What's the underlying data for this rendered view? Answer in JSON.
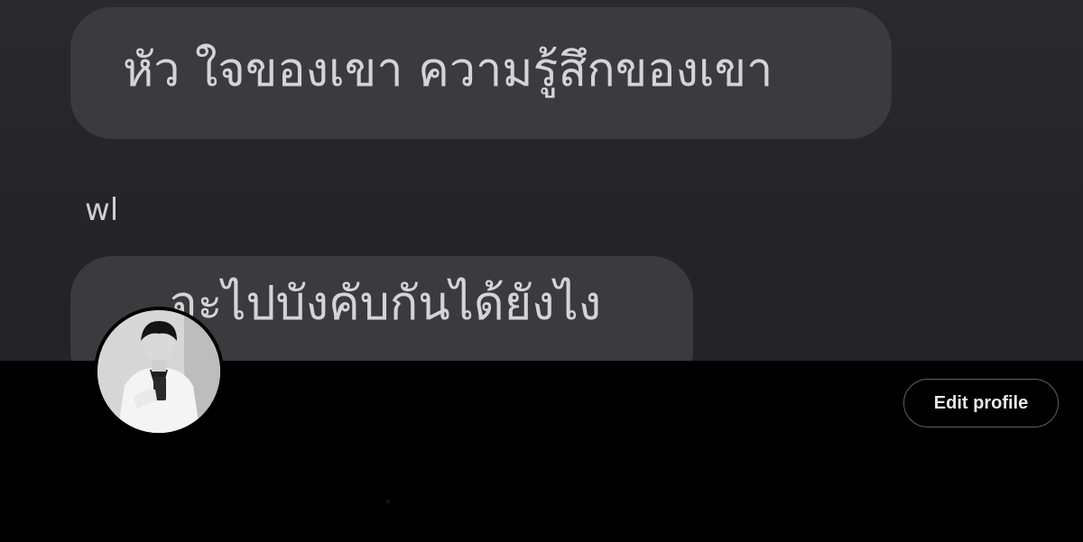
{
  "banner": {
    "messages": [
      {
        "text": "หัว ใจของเขา ความรู้สึกของเขา"
      },
      {
        "text": "จะไปบังคับกันได้ยังไง"
      }
    ],
    "sender_label": "wl"
  },
  "profile": {
    "avatar_icon": "profile-photo",
    "edit_profile_label": "Edit profile"
  },
  "colors": {
    "page_background": "#000000",
    "banner_background": "#252529",
    "bubble_background": "#3b3b3f",
    "bubble_text": "#d4d4d6",
    "button_border": "#536471",
    "button_text": "#e7e9ea"
  }
}
